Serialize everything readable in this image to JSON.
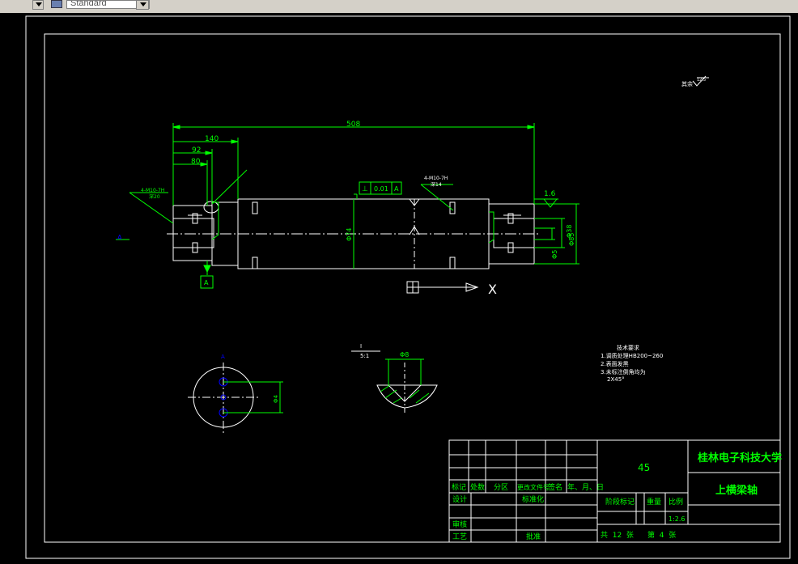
{
  "toolbar": {
    "style_dropdown_value": "Standard"
  },
  "drawing": {
    "colors": {
      "background": "#000000",
      "outline": "#ffffff",
      "dimension": "#00ff00",
      "centerline": "#ffffff",
      "accent": "#0000ff"
    },
    "roughness_note": "其余",
    "roughness_value": "12.5",
    "dim_overall_length": "508",
    "dim_140": "140",
    "dim_92": "92",
    "dim_80": "80",
    "dim_diameter_main": "Φ74",
    "dim_right_1": "Φ38",
    "dim_right_2": "Φ85",
    "dim_right_3": "Φ5",
    "dim_right_roughness": "1.6",
    "left_callout_1": "4-M10-7H",
    "left_callout_2": "深20",
    "right_callout_1": "4-M10-7H",
    "right_callout_2": "深14",
    "tolerance_symbol": "⊥",
    "tolerance_value": "0.01",
    "tolerance_datum": "A",
    "datum_label": "A",
    "detail_label_top": "I",
    "detail_scale": "5:1",
    "detail_dim": "Φ8",
    "section_dim": "Φ4",
    "section_label": "A",
    "axis_x_label": "X",
    "tech_title": "技术要求",
    "tech_items": [
      "1.调质处理HB200~260",
      "2.表面发黑",
      "3.未标注倒角均为",
      "2X45°"
    ]
  },
  "title_block": {
    "material": "45",
    "university": "桂林电子科技大学",
    "part_name": "上横梁轴",
    "col_labels": [
      "标记",
      "处数",
      "分区",
      "更改文件号",
      "签名",
      "年、月、日"
    ],
    "design_label": "设计",
    "standard_label": "标准化",
    "review_label": "审核",
    "process_label": "工艺",
    "approve_label": "批准",
    "stage_label": "阶段标记",
    "weight_label": "重量",
    "scale_label": "比例",
    "scale_value": "1:2.6",
    "sheet_info": "共  12  张      第  4  张"
  }
}
